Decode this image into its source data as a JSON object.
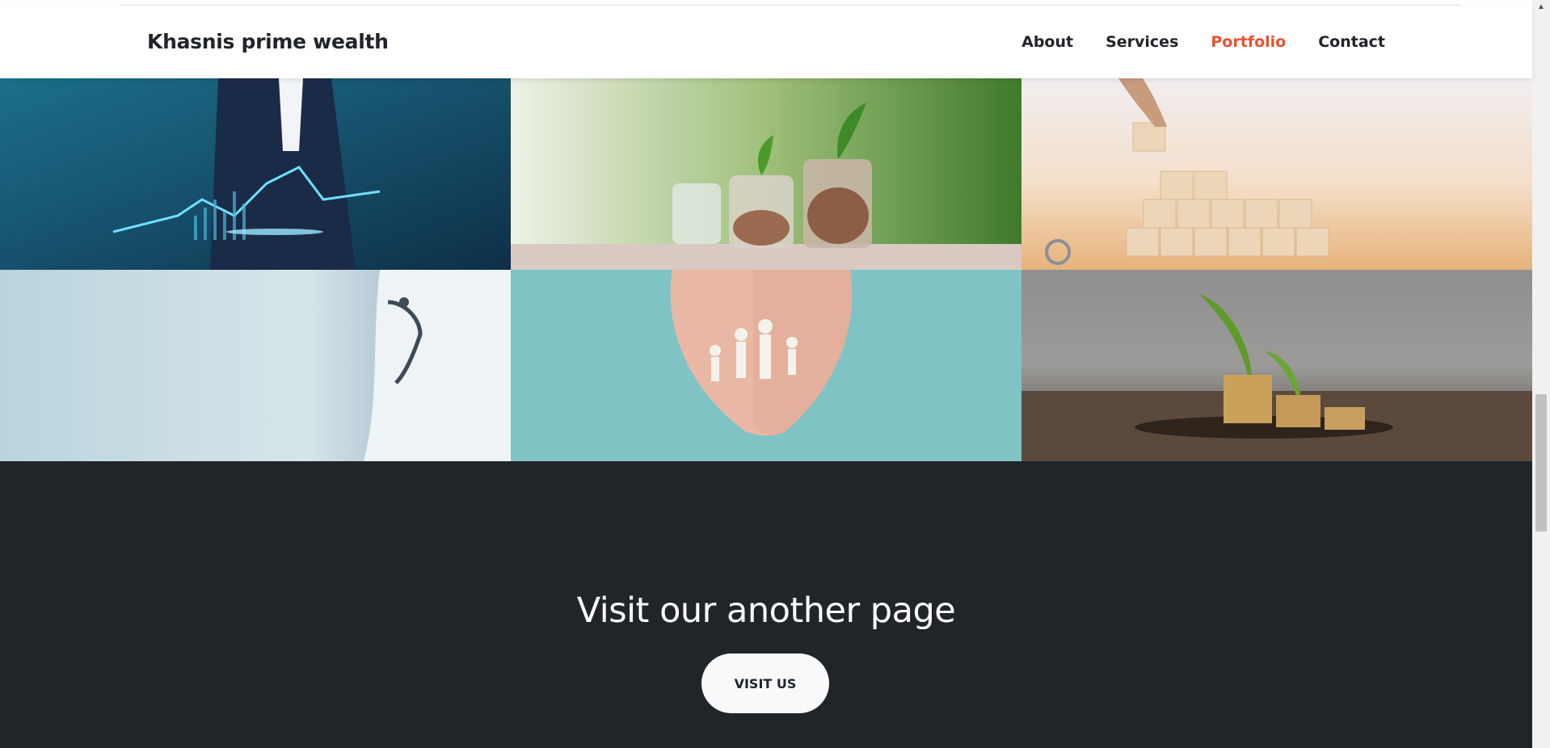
{
  "navbar": {
    "brand": "Khasnis prime wealth",
    "links": [
      {
        "label": "About",
        "active": false
      },
      {
        "label": "Services",
        "active": false
      },
      {
        "label": "Portfolio",
        "active": true
      },
      {
        "label": "Contact",
        "active": false
      }
    ]
  },
  "portfolio": {
    "tiles": [
      {
        "name": "business-analytics-image"
      },
      {
        "name": "savings-jars-image"
      },
      {
        "name": "health-blocks-image"
      },
      {
        "name": "doctor-image"
      },
      {
        "name": "family-hands-image"
      },
      {
        "name": "coins-plant-image"
      }
    ]
  },
  "cta": {
    "title": "Visit our another page",
    "button_label": "VISIT US"
  },
  "colors": {
    "accent": "#e8532f",
    "dark_bg": "#212529",
    "text": "#212529"
  }
}
